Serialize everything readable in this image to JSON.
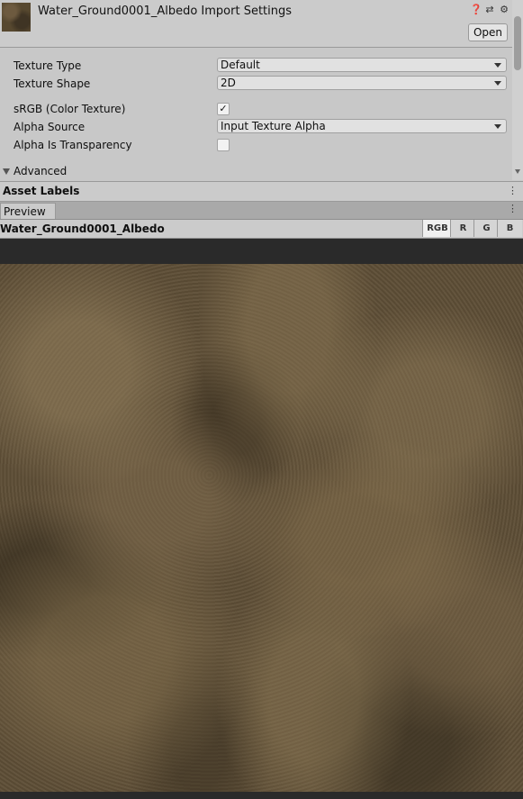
{
  "header": {
    "title": "Water_Ground0001_Albedo Import Settings",
    "open_label": "Open",
    "icons": [
      "help-icon",
      "preset-icon",
      "settings-gear-icon"
    ]
  },
  "settings": {
    "texture_type": {
      "label": "Texture Type",
      "value": "Default"
    },
    "texture_shape": {
      "label": "Texture Shape",
      "value": "2D"
    },
    "srgb": {
      "label": "sRGB (Color Texture)",
      "checked": true,
      "mark": "✓"
    },
    "alpha_source": {
      "label": "Alpha Source",
      "value": "Input Texture Alpha"
    },
    "alpha_transparency": {
      "label": "Alpha Is Transparency",
      "checked": false
    },
    "advanced_label": "Advanced"
  },
  "asset_labels": {
    "label": "Asset Labels"
  },
  "preview": {
    "tab_label": "Preview",
    "asset_name": "Water_Ground0001_Albedo",
    "channels": [
      "RGB",
      "R",
      "G",
      "B"
    ],
    "active_channel": "RGB"
  }
}
